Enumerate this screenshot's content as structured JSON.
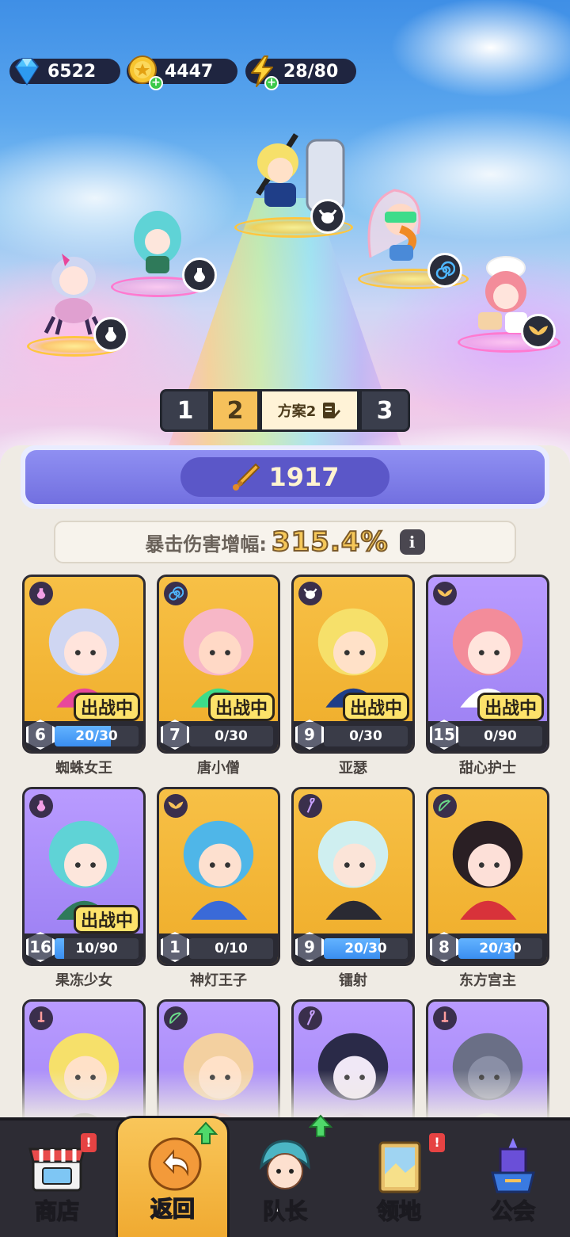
{
  "currency": {
    "gems": "6522",
    "coins": "4447",
    "energy": "28/80"
  },
  "team_tabs": {
    "tab1": "1",
    "tab2": "2",
    "plan_name": "方案2",
    "tab3": "3",
    "selected": "2"
  },
  "power": "1917",
  "crit": {
    "label": "暴击伤害增幅:",
    "value": "315.4%"
  },
  "cards": [
    {
      "name": "蜘蛛女王",
      "level": "6",
      "progress": "20/30",
      "fraction": 0.67,
      "deployed": true,
      "bg": "gold",
      "class_icon": "potion-icon",
      "deploy_label": "出战中"
    },
    {
      "name": "唐小僧",
      "level": "7",
      "progress": "0/30",
      "fraction": 0.0,
      "deployed": true,
      "bg": "gold",
      "class_icon": "spiral-icon",
      "deploy_label": "出战中"
    },
    {
      "name": "亚瑟",
      "level": "9",
      "progress": "0/30",
      "fraction": 0.0,
      "deployed": true,
      "bg": "gold",
      "class_icon": "bull-icon",
      "deploy_label": "出战中"
    },
    {
      "name": "甜心护士",
      "level": "15",
      "progress": "0/90",
      "fraction": 0.0,
      "deployed": true,
      "bg": "purple",
      "class_icon": "wings-icon",
      "deploy_label": "出战中"
    },
    {
      "name": "果冻少女",
      "level": "16",
      "progress": "10/90",
      "fraction": 0.11,
      "deployed": true,
      "bg": "purple",
      "class_icon": "potion-icon",
      "deploy_label": "出战中"
    },
    {
      "name": "神灯王子",
      "level": "1",
      "progress": "0/10",
      "fraction": 0.0,
      "deployed": false,
      "bg": "gold",
      "class_icon": "wings-icon",
      "deploy_label": ""
    },
    {
      "name": "镭射",
      "level": "9",
      "progress": "20/30",
      "fraction": 0.67,
      "deployed": false,
      "bg": "gold",
      "class_icon": "staff-icon",
      "deploy_label": ""
    },
    {
      "name": "东方宫主",
      "level": "8",
      "progress": "20/30",
      "fraction": 0.67,
      "deployed": false,
      "bg": "gold",
      "class_icon": "bow-icon",
      "deploy_label": ""
    },
    {
      "name": "",
      "level": "",
      "progress": "",
      "fraction": 0,
      "deployed": false,
      "bg": "purple",
      "class_icon": "sword-icon",
      "deploy_label": ""
    },
    {
      "name": "",
      "level": "",
      "progress": "",
      "fraction": 0,
      "deployed": false,
      "bg": "purple",
      "class_icon": "bow-icon",
      "deploy_label": ""
    },
    {
      "name": "",
      "level": "",
      "progress": "",
      "fraction": 0,
      "deployed": false,
      "bg": "purple",
      "class_icon": "staff-icon",
      "deploy_label": ""
    },
    {
      "name": "",
      "level": "",
      "progress": "",
      "fraction": 0,
      "deployed": false,
      "bg": "purple",
      "class_icon": "sword-icon",
      "deploy_label": ""
    }
  ],
  "nav": {
    "shop": "商店",
    "back": "返回",
    "captain": "队长",
    "territory": "领地",
    "guild": "公会",
    "alert_mark": "!"
  },
  "colors": {
    "accent_gold": "#f6c15b",
    "power_purple": "#7270e0",
    "progress_blue": "#3a8ef0"
  }
}
